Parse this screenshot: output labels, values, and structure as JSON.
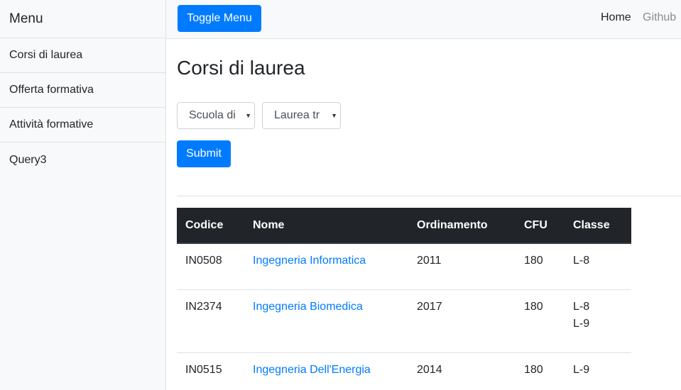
{
  "sidebar": {
    "heading": "Menu",
    "items": [
      {
        "label": "Corsi di laurea"
      },
      {
        "label": "Offerta formativa"
      },
      {
        "label": "Attività formative"
      },
      {
        "label": "Query3"
      }
    ]
  },
  "navbar": {
    "toggle_label": "Toggle Menu",
    "links": [
      {
        "label": "Home"
      },
      {
        "label": "Github"
      }
    ]
  },
  "page": {
    "title": "Corsi di laurea"
  },
  "filters": {
    "school_selected": "Scuola di",
    "type_selected": "Laurea tr",
    "submit_label": "Submit"
  },
  "table": {
    "headers": [
      "Codice",
      "Nome",
      "Ordinamento",
      "CFU",
      "Classe"
    ],
    "rows": [
      {
        "code": "IN0508",
        "name": "Ingegneria Informatica",
        "ordinamento": "2011",
        "cfu": "180",
        "classi": [
          "L-8"
        ]
      },
      {
        "code": "IN2374",
        "name": "Ingegneria Biomedica",
        "ordinamento": "2017",
        "cfu": "180",
        "classi": [
          "L-8",
          "L-9"
        ]
      },
      {
        "code": "IN0515",
        "name": "Ingegneria Dell'Energia",
        "ordinamento": "2014",
        "cfu": "180",
        "classi": [
          "L-9"
        ]
      }
    ]
  },
  "colors": {
    "primary": "#007bff",
    "table_header_bg": "#212529",
    "sidebar_bg": "#f8f9fa"
  }
}
